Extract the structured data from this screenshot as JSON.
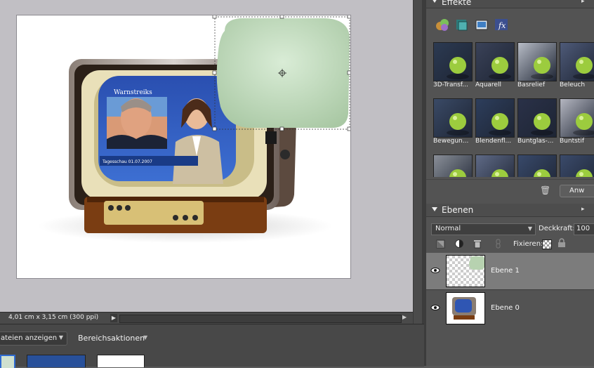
{
  "document": {
    "info": "4,01 cm x 3,15 cm (300 ppi)",
    "tv_headline": "Warnstreiks",
    "tv_caption": "Tagesschau 01.07.2007"
  },
  "bin": {
    "show_files_label": "ateien anzeigen",
    "area_actions_label": "Bereichsaktionen"
  },
  "effects": {
    "title": "Effekte",
    "tools": [
      "layer-styles-icon",
      "filters-icon",
      "photo-effects-icon",
      "fx-icon"
    ],
    "items": [
      {
        "label": "3D-Transf...",
        "color": "#2c3a52"
      },
      {
        "label": "Aquarell",
        "color": "#3a4258"
      },
      {
        "label": "Basrelief",
        "color": "#b7bcc6"
      },
      {
        "label": "Beleuch",
        "color": "#4e5a78"
      },
      {
        "label": "Bewegun...",
        "color": "#3a4a66"
      },
      {
        "label": "Blendenfl...",
        "color": "#2d3e5c"
      },
      {
        "label": "Buntglas-...",
        "color": "#2a3148"
      },
      {
        "label": "Buntstif",
        "color": "#b4b6c0"
      },
      {
        "label": "",
        "color": "#8a8f98"
      },
      {
        "label": "",
        "color": "#5f6a86"
      },
      {
        "label": "",
        "color": "#38496a"
      },
      {
        "label": "",
        "color": "#3a4a6a"
      }
    ],
    "apply_label": "Anw"
  },
  "layers": {
    "title": "Ebenen",
    "blend_mode": "Normal",
    "opacity_label": "Deckkraft:",
    "opacity_value": "100",
    "fix_label": "Fixieren:",
    "items": [
      {
        "name": "Ebene 1",
        "selected": true
      },
      {
        "name": "Ebene 0",
        "selected": false
      }
    ]
  }
}
